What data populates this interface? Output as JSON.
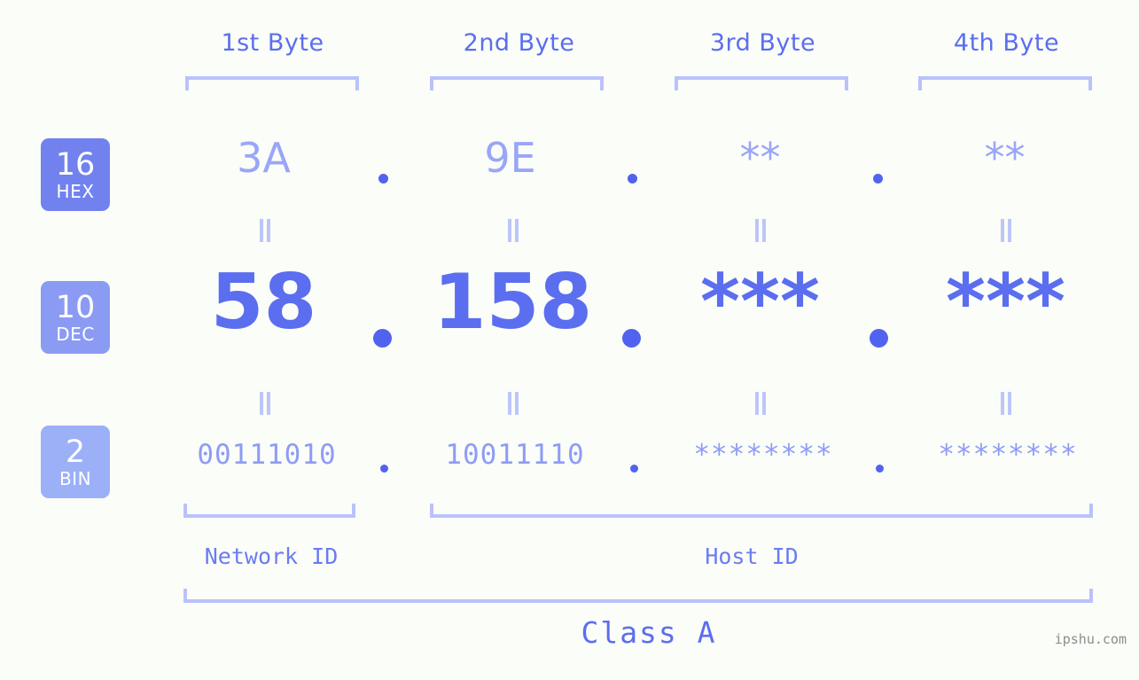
{
  "headers": [
    {
      "label": "1st Byte"
    },
    {
      "label": "2nd Byte"
    },
    {
      "label": "3rd Byte"
    },
    {
      "label": "4th Byte"
    }
  ],
  "bases": [
    {
      "number": "16",
      "name": "HEX",
      "color": "#7182ee"
    },
    {
      "number": "10",
      "name": "DEC",
      "color": "#8b9bf4"
    },
    {
      "number": "2",
      "name": "BIN",
      "color": "#9cb0f7"
    }
  ],
  "rows": {
    "hex": {
      "values": [
        "3A",
        "9E",
        "**",
        "**"
      ]
    },
    "dec": {
      "values": [
        "58",
        "158",
        "***",
        "***"
      ]
    },
    "bin": {
      "values": [
        "00111010",
        "10011110",
        "********",
        "********"
      ]
    }
  },
  "separator": ".",
  "segments": {
    "network_id": "Network ID",
    "host_id": "Host ID"
  },
  "class_label": "Class A",
  "watermark": "ipshu.com",
  "colors": {
    "background": "#fbfdf8",
    "bracket": "#b9c2fb",
    "header_text": "#5b6ef0",
    "hex_text": "#99a6f7",
    "dec_text": "#5b6ef0",
    "bin_text": "#8e9cf6",
    "dot": "#5163ee",
    "connector": "#bcc5fc",
    "watermark_text": "#8c8c8c"
  }
}
